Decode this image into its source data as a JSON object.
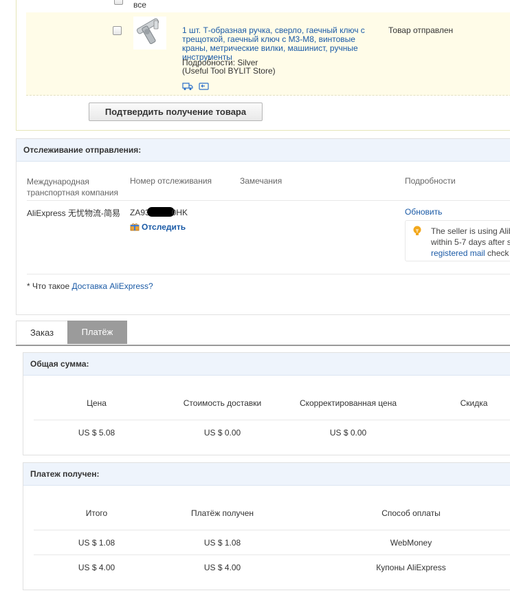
{
  "order": {
    "top_partial_text": "все",
    "item": {
      "title": "1 шт. Т-образная ручка, сверло, гаечный ключ с трещоткой, гаечный ключ с M3-M8, винтовые краны, метрические вилки, машинист, ручные инструменты",
      "details": "Подробности: Silver",
      "store": "(Useful Tool BYLIT Store)",
      "status": "Товар отправлен",
      "icons": [
        "truck-icon",
        "card-icon"
      ]
    },
    "confirm_button": "Подтвердить получение товара"
  },
  "tracking": {
    "title": "Отслеживание отправления:",
    "headers": {
      "carrier": "Международная транспортная компания",
      "number": "Номер отслеживания",
      "remarks": "Замечания",
      "details": "Подробности"
    },
    "row": {
      "carrier": "AliExpress 无忧物流-简易",
      "number_start": "ZA93",
      "number_end": "0HK",
      "track_link": "Отследить",
      "refresh_link": "Обновить",
      "tip_line1": "The seller is using Alib",
      "tip_line2": "within 5-7 days after s",
      "tip_link": "registered mail",
      "tip_line3_rest": " check"
    },
    "footnote_prefix": "* Что такое ",
    "footnote_link": "Доставка AliExpress?"
  },
  "tabs": [
    {
      "label": "Заказ",
      "active": false
    },
    {
      "label": "Платёж",
      "active": true
    }
  ],
  "total": {
    "title": "Общая сумма:",
    "headers": [
      "Цена",
      "Стоимость доставки",
      "Скорректированная цена",
      "Скидка"
    ],
    "values": [
      "US $ 5.08",
      "US $ 0.00",
      "US $ 0.00",
      ""
    ]
  },
  "payment": {
    "title": "Платеж получен:",
    "headers": [
      "Итого",
      "Платёж получен",
      "Способ оплаты"
    ],
    "rows": [
      [
        "US $ 1.08",
        "US $ 1.08",
        "WebMoney"
      ],
      [
        "US $ 4.00",
        "US $ 4.00",
        "Купоны AliExpress"
      ]
    ]
  },
  "colors": {
    "link": "#1a5aa6",
    "highlight_row": "#fffce8",
    "panel_header": "#eef4fc",
    "active_tab": "#9b9b9b"
  }
}
